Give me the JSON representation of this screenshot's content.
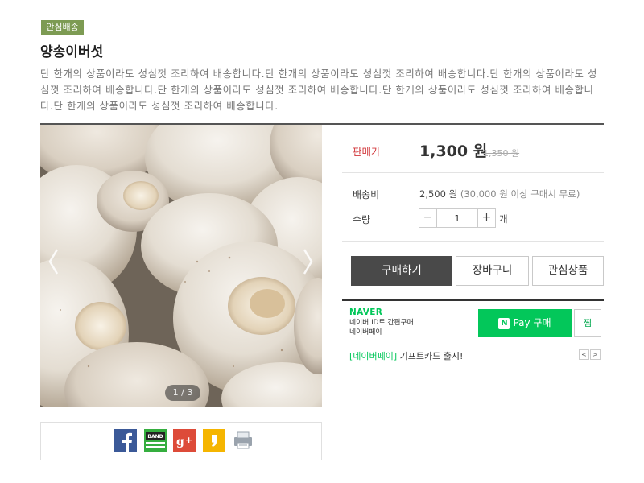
{
  "product": {
    "badge": "안심배송",
    "title": "양송이버섯",
    "description": "단 한개의 상품이라도 성심껏 조리하여 배송합니다.단 한개의 상품이라도 성심껏 조리하여 배송합니다.단 한개의 상품이라도 성심껏 조리하여 배송합니다.단 한개의 상품이라도 성심껏 조리하여 배송합니다.단 한개의 상품이라도 성심껏 조리하여 배송합니다.단 한개의 상품이라도 성심껏 조리하여 배송합니다."
  },
  "gallery": {
    "counter": "1 / 3",
    "prev_icon": "chevron-left-icon",
    "next_icon": "chevron-right-icon"
  },
  "share": {
    "icons": [
      "facebook-icon",
      "band-icon",
      "google-plus-icon",
      "kakaostory-icon",
      "print-icon"
    ],
    "colors": {
      "facebook": "#3b5998",
      "band": "#35ae3f",
      "google_plus": "#dd4b39",
      "kakaostory": "#f5b500",
      "print": "#9aa3ad"
    }
  },
  "pricing": {
    "price_label": "판매가",
    "price": "1,300 원",
    "original_price": "1,350 원",
    "shipping_label": "배송비",
    "shipping_value": "2,500 원",
    "shipping_note": "(30,000 원 이상 구매시 무료)",
    "quantity_label": "수량",
    "quantity_value": "1",
    "quantity_unit": "개",
    "minus": "−",
    "plus": "+"
  },
  "actions": {
    "buy": "구매하기",
    "cart": "장바구니",
    "wish": "관심상품"
  },
  "naver": {
    "logo": "NAVER",
    "sub1": "네이버 ID로 간편구매",
    "sub2": "네이버페이",
    "npay_n": "N",
    "npay_label": "Pay 구매",
    "zzim": "찜",
    "promo_tag": "[네이버페이]",
    "promo_text": " 기프트카드 출시!",
    "promo_prev": "<",
    "promo_next": ">",
    "brand_color": "#03c75a"
  }
}
